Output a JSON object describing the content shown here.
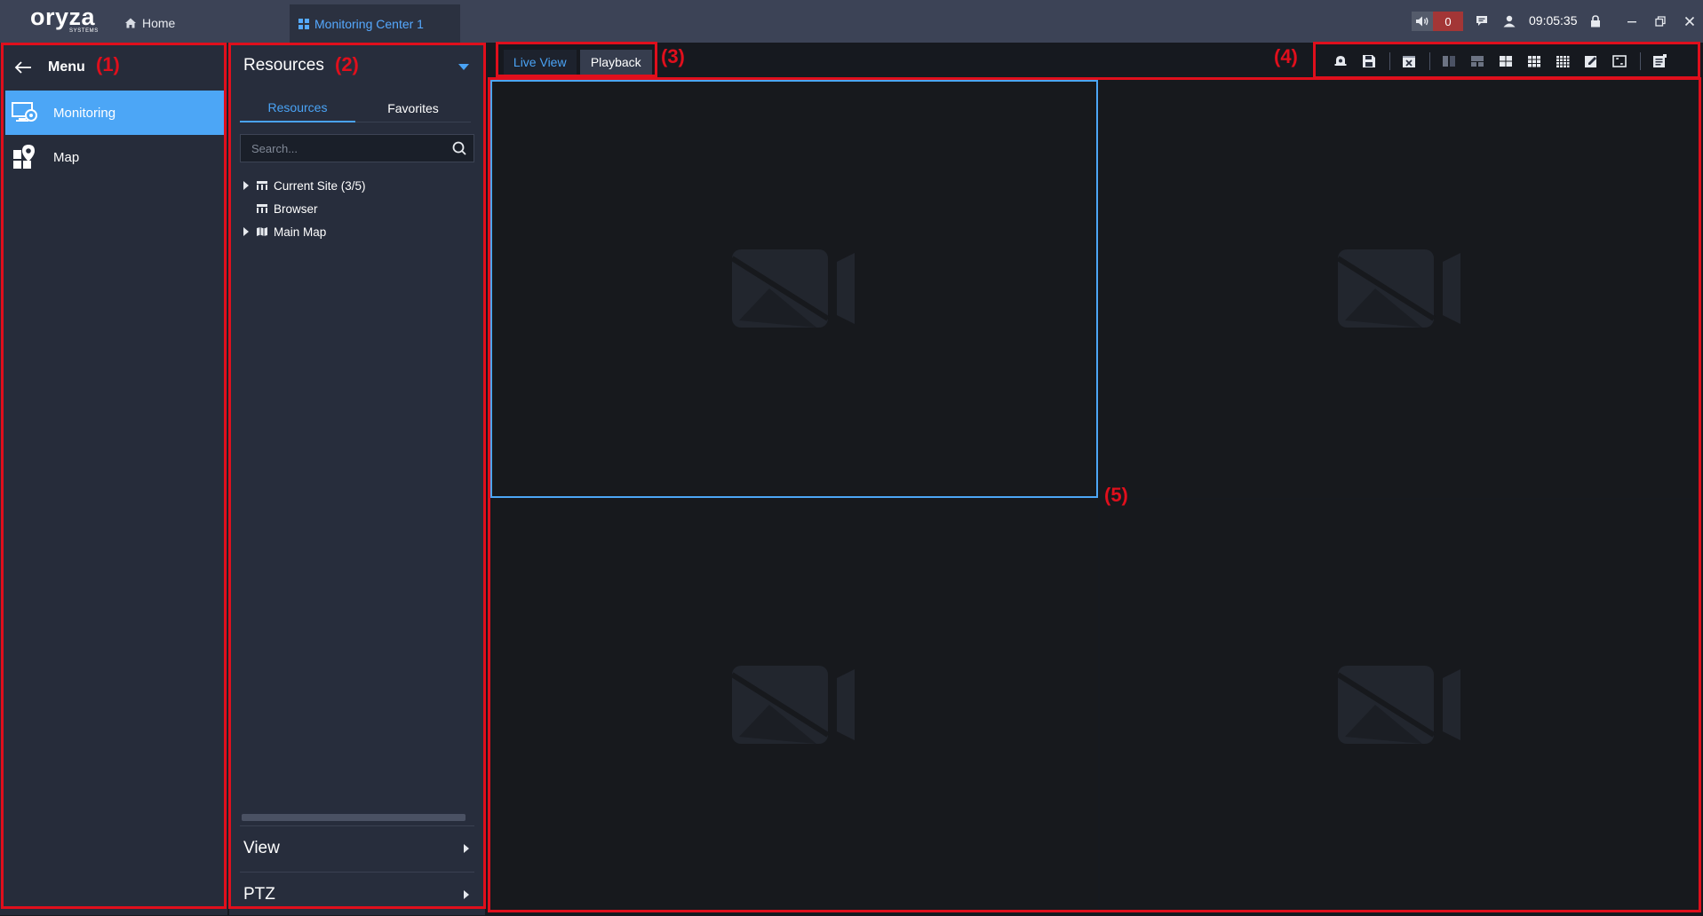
{
  "app": {
    "brand": "oryza",
    "brand_sub": "SYSTEMS",
    "home_label": "Home",
    "active_tab_label": "Monitoring Center 1",
    "alarm_count": "0",
    "clock": "09:05:35"
  },
  "menu": {
    "title": "Menu",
    "items": [
      {
        "label": "Monitoring",
        "icon": "monitoring-icon",
        "active": true
      },
      {
        "label": "Map",
        "icon": "map-pin-icon",
        "active": false
      }
    ]
  },
  "resources": {
    "title": "Resources",
    "tabs": [
      {
        "label": "Resources",
        "active": true
      },
      {
        "label": "Favorites",
        "active": false
      }
    ],
    "search_placeholder": "Search...",
    "tree": [
      {
        "label": "Current Site (3/5)",
        "icon": "site-icon",
        "expandable": true
      },
      {
        "label": "Browser",
        "icon": "site-icon",
        "expandable": false
      },
      {
        "label": "Main Map",
        "icon": "map-icon",
        "expandable": true
      }
    ],
    "sections": [
      {
        "label": "View"
      },
      {
        "label": "PTZ"
      }
    ]
  },
  "view_mode": {
    "tabs": [
      {
        "label": "Live View",
        "active": true
      },
      {
        "label": "Playback",
        "active": false
      }
    ]
  },
  "toolbar": {
    "icons": [
      "alarm-icon",
      "save-icon",
      "close-all-icon",
      "layout-1x2-icon",
      "layout-custom-icon",
      "layout-2x2-icon",
      "layout-3x3-icon",
      "layout-4x4-icon",
      "edit-layout-icon",
      "fullscreen-icon",
      "task-list-icon"
    ]
  },
  "video_grid": {
    "layout": "2x2",
    "selected_pane": 1
  },
  "annotations": {
    "labels": [
      "(1)",
      "(2)",
      "(3)",
      "(4)",
      "(5)"
    ],
    "color": "#e00f1c"
  },
  "colors": {
    "accent": "#4ca6f6",
    "titlebar": "#3c4356",
    "panel": "#262c3a",
    "alarm": "#a33636"
  }
}
